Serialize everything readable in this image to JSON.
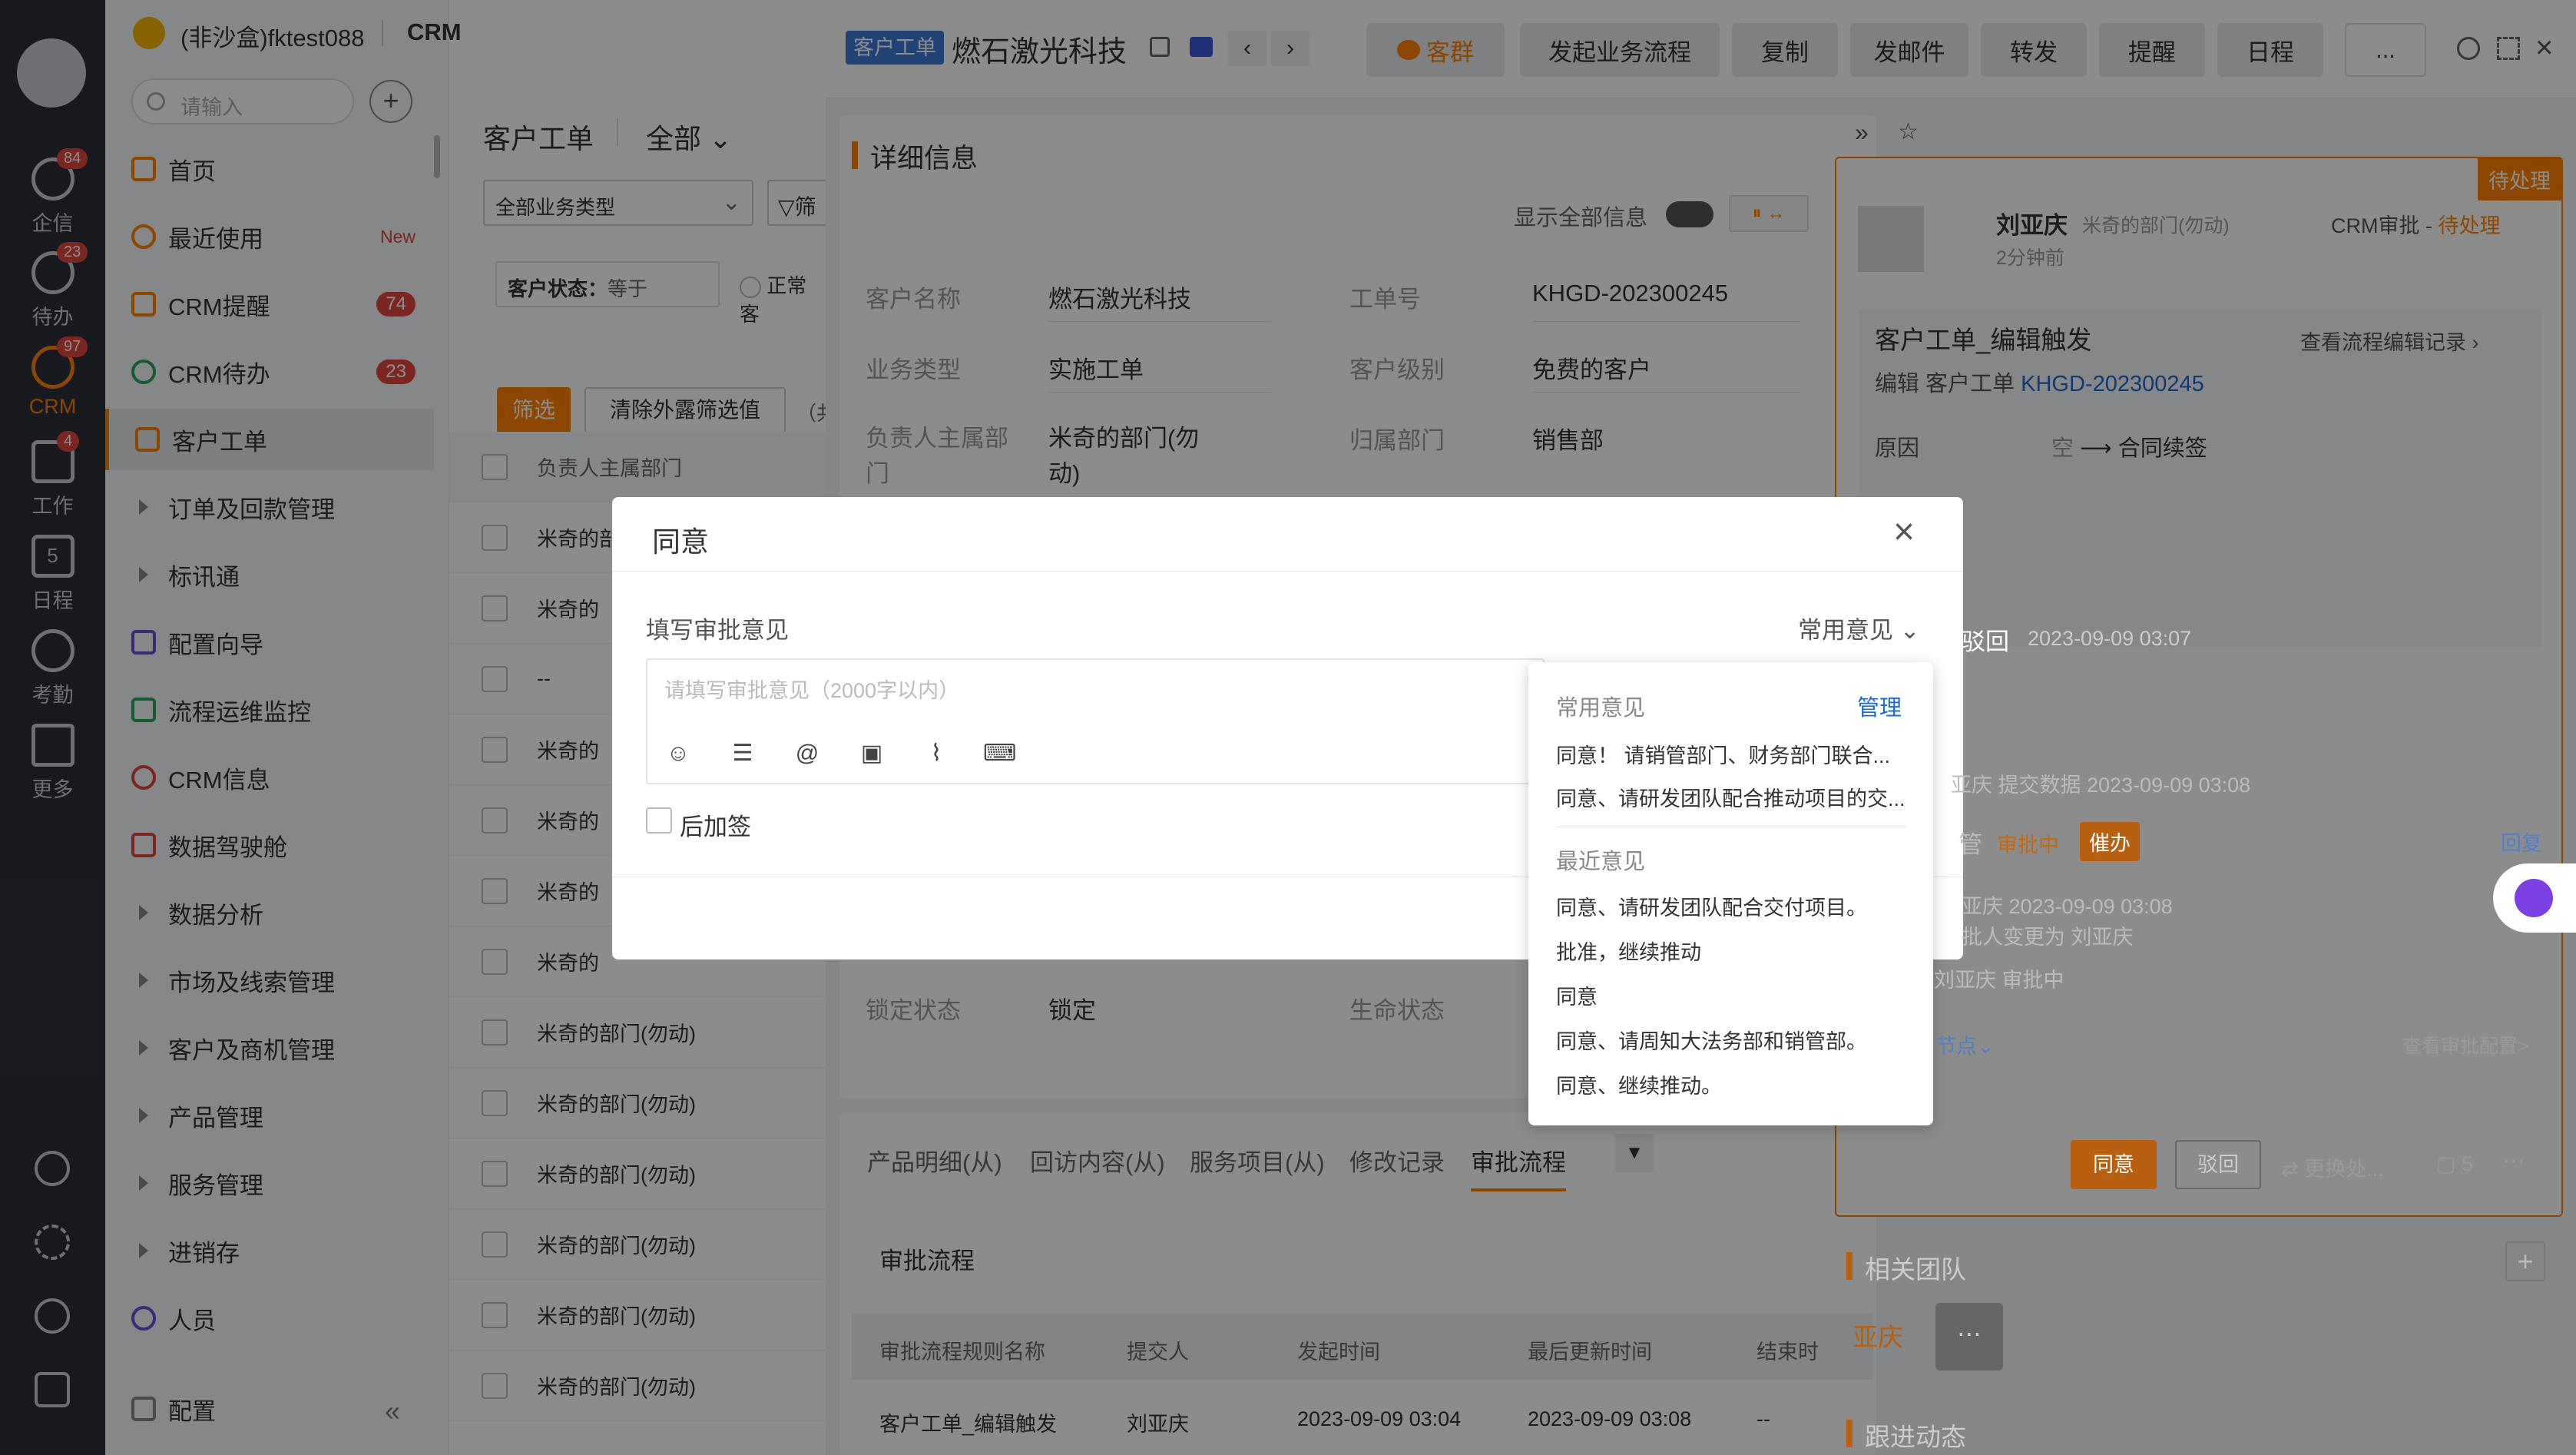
{
  "rail": {
    "items": [
      {
        "label": "企信",
        "badge": "84"
      },
      {
        "label": "待办",
        "badge": "23"
      },
      {
        "label": "CRM",
        "badge": "97"
      },
      {
        "label": "工作",
        "badge": "4"
      },
      {
        "label": "日程",
        "badge": ""
      },
      {
        "label": "考勤",
        "badge": ""
      },
      {
        "label": "更多",
        "badge": ""
      }
    ],
    "calendar_day": "5"
  },
  "header": {
    "company": "(非沙盒)fktest088",
    "app": "CRM"
  },
  "nav": {
    "search_placeholder": "请输入",
    "items": [
      {
        "label": "首页",
        "badge": ""
      },
      {
        "label": "最近使用",
        "badge": "",
        "tag": "New"
      },
      {
        "label": "CRM提醒",
        "badge": "74"
      },
      {
        "label": "CRM待办",
        "badge": "23"
      },
      {
        "label": "客户工单",
        "badge": ""
      },
      {
        "label": "订单及回款管理",
        "badge": ""
      },
      {
        "label": "标讯通",
        "badge": ""
      },
      {
        "label": "配置向导",
        "badge": ""
      },
      {
        "label": "流程运维监控",
        "badge": ""
      },
      {
        "label": "CRM信息",
        "badge": ""
      },
      {
        "label": "数据驾驶舱",
        "badge": ""
      },
      {
        "label": "数据分析",
        "badge": ""
      },
      {
        "label": "市场及线索管理",
        "badge": ""
      },
      {
        "label": "客户及商机管理",
        "badge": ""
      },
      {
        "label": "产品管理",
        "badge": ""
      },
      {
        "label": "服务管理",
        "badge": ""
      },
      {
        "label": "进销存",
        "badge": ""
      },
      {
        "label": "人员",
        "badge": ""
      }
    ],
    "config": "配置"
  },
  "list": {
    "title": "客户工单",
    "scope": "全部",
    "type_select": "全部业务类型",
    "filter_btn": "筛",
    "status_filter": "客户状态：",
    "status_op": "等于",
    "normal": "正常客",
    "filter_action": "筛选",
    "clear_action": "清除外露筛选值",
    "total": "（共",
    "column": "负责人主属部门",
    "rows": [
      "米奇的部门(勿动)",
      "米奇的",
      "--",
      "米奇的",
      "米奇的",
      "米奇的",
      "米奇的",
      "米奇的部门(勿动)",
      "米奇的部门(勿动)",
      "米奇的部门(勿动)",
      "米奇的部门(勿动)",
      "米奇的部门(勿动)",
      "米奇的部门(勿动)"
    ]
  },
  "detail": {
    "tag": "客户工单",
    "title": "燃石激光科技",
    "buttons": [
      "客群",
      "发起业务流程",
      "复制",
      "发邮件",
      "转发",
      "提醒",
      "日程",
      "..."
    ],
    "section_title": "详细信息",
    "show_all": "显示全部信息",
    "fields": [
      {
        "label": "客户名称",
        "value": "燃石激光科技"
      },
      {
        "label": "工单号",
        "value": "KHGD-202300245"
      },
      {
        "label": "业务类型",
        "value": "实施工单"
      },
      {
        "label": "客户级别",
        "value": "免费的客户"
      },
      {
        "label": "负责人主属部门",
        "value": "米奇的部门(勿动)"
      },
      {
        "label": "归属部门",
        "value": "销售部"
      },
      {
        "label": "锁定状态",
        "value": "锁定"
      },
      {
        "label": "生命状态",
        "value": ""
      }
    ],
    "tabs": [
      "产品明细(从)",
      "回访内容(从)",
      "服务项目(从)",
      "修改记录",
      "审批流程"
    ],
    "approval_title": "审批流程",
    "table_headers": [
      "审批流程规则名称",
      "提交人",
      "发起时间",
      "最后更新时间",
      "结束时"
    ],
    "table_row": [
      "客户工单_编辑触发",
      "刘亚庆",
      "2023-09-09 03:04",
      "2023-09-09 03:08",
      "--"
    ]
  },
  "flow": {
    "status_tag": "待处理",
    "user": "刘亚庆",
    "dept": "米奇的部门(勿动)",
    "time_ago": "2分钟前",
    "crm_label": "CRM审批 - ",
    "crm_status": "待处理",
    "edit_title": "客户工单_编辑触发",
    "edit_link": "查看流程编辑记录",
    "edit_desc": "编辑 客户工单",
    "edit_code": "KHGD-202300245",
    "reason_label": "原因",
    "reason_from": "空",
    "reason_to": "合同续签",
    "reject_text": "驳回",
    "reject_time": "2023-09-09 03:07",
    "submit_text": "亚庆 提交数据 2023-09-09 03:08",
    "mgr": "管",
    "mgr_status": "审批中",
    "urge": "催办",
    "reply": "回复",
    "log1": "亚庆  2023-09-09 03:08",
    "log2": "批人变更为 刘亚庆",
    "log3": "刘亚庆  审批中",
    "node": "节点",
    "cfg": "查看审批配置>",
    "agree": "同意",
    "reject": "驳回",
    "change": "更换处...",
    "comments": "5",
    "team": "相关团队",
    "member": "亚庆",
    "follow": "跟进动态"
  },
  "modal": {
    "title": "同意",
    "opinion_label": "填写审批意见",
    "common_btn": "常用意见",
    "placeholder": "请填写审批意见（2000字以内）",
    "countersign": "后加签"
  },
  "dropdown": {
    "common_title": "常用意见",
    "manage": "管理",
    "common": [
      "同意！ 请销管部门、财务部门联合...",
      "同意、请研发团队配合推动项目的交..."
    ],
    "recent_title": "最近意见",
    "recent": [
      "同意、请研发团队配合交付项目。",
      "批准，继续推动",
      "同意",
      "同意、请周知大法务部和销管部。",
      "同意、继续推动。"
    ]
  },
  "colors": {
    "accent": "#ff8000",
    "link": "#1a6bd6",
    "danger": "#e2453c",
    "rail": "#2b2f3a"
  }
}
